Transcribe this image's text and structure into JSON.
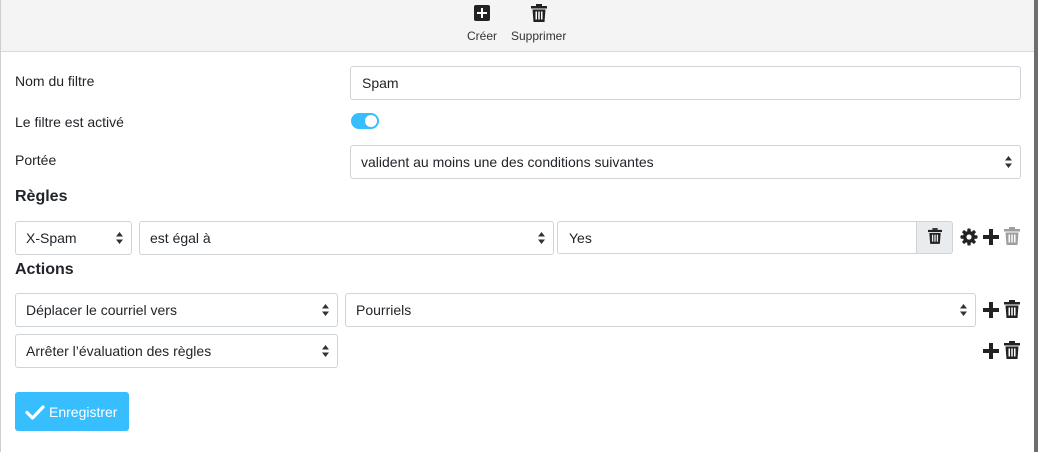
{
  "toolbar": {
    "create_label": "Créer",
    "delete_label": "Supprimer"
  },
  "form": {
    "name_label": "Nom du filtre",
    "name_value": "Spam",
    "enabled_label": "Le filtre est activé",
    "enabled": true,
    "scope_label": "Portée",
    "scope_value": "valident au moins une des conditions suivantes"
  },
  "rules": {
    "heading": "Règles",
    "items": [
      {
        "header": "X-Spam",
        "operator": "est égal à",
        "value": "Yes"
      }
    ]
  },
  "actions": {
    "heading": "Actions",
    "items": [
      {
        "action": "Déplacer le courriel vers",
        "target": "Pourriels"
      },
      {
        "action": "Arrêter l’évaluation des règles"
      }
    ]
  },
  "save_label": "Enregistrer",
  "colors": {
    "accent": "#37beff",
    "toolbar_bg": "#f4f4f4",
    "disabled_icon": "#9e9e9e"
  }
}
